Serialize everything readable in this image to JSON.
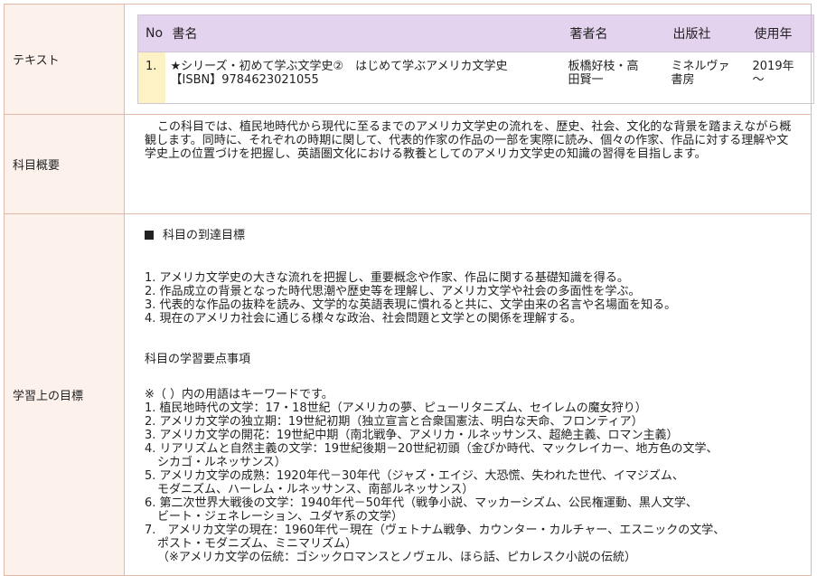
{
  "sections": {
    "text_label": "テキスト",
    "summary_label": "科目概要",
    "goals_label": "学習上の目標"
  },
  "books": {
    "headers": {
      "no": "No",
      "title": "書名",
      "author": "著者名",
      "publisher": "出版社",
      "year": "使用年"
    },
    "rows": [
      {
        "no": "1.",
        "title_line1": "★シリーズ・初めて学ぶ文学史②　はじめて学ぶアメリカ文学史",
        "title_line2": "【ISBN】9784623021055",
        "author_line1": "板橋好枝・高",
        "author_line2": "田賢一",
        "publisher_line1": "ミネルヴァ",
        "publisher_line2": "書房",
        "year_line1": "2019年",
        "year_line2": "～"
      }
    ]
  },
  "summary": "この科目では、植民地時代から現代に至るまでのアメリカ文学史の流れを、歴史、社会、文化的な背景を踏まえながら概観します。同時に、それぞれの時期に関して、代表的作家の作品の一部を実際に読み、個々の作家、作品に対する理解や文学史上の位置づけを把握し、英語圏文化における教養としてのアメリカ文学史の知識の習得を目指します。",
  "goals": {
    "heading1": "科目の到達目標",
    "targets": [
      "1. アメリカ文学史の大きな流れを把握し、重要概念や作家、作品に関する基礎知識を得る。",
      "2. 作品成立の背景となった時代思潮や歴史等を理解し、アメリカ文学や社会の多面性を学ぶ。",
      "3. 代表的な作品の抜粋を読み、文学的な英語表現に慣れると共に、文学由来の名言や名場面を知る。",
      "4. 現在のアメリカ社会に通じる様々な政治、社会問題と文学との関係を理解する。"
    ],
    "heading2": "科目の学習要点事項",
    "note": "※（ ）内の用語はキーワードです。",
    "points": [
      {
        "line1": "1. 植民地時代の文学：17・18世紀（アメリカの夢、ピューリタニズム、セイレムの魔女狩り）",
        "line2": ""
      },
      {
        "line1": "2. アメリカ文学の独立期：19世紀初期（独立宣言と合衆国憲法、明白な天命、フロンティア）",
        "line2": ""
      },
      {
        "line1": "3. アメリカ文学の開花：19世紀中期（南北戦争、アメリカ・ルネッサンス、超絶主義、ロマン主義）",
        "line2": ""
      },
      {
        "line1": "4. リアリズムと自然主義の文学：19世紀後期－20世紀初頭（金ぴか時代、マックレイカー、地方色の文学、",
        "line2": "シカゴ・ルネッサンス）"
      },
      {
        "line1": "5. アメリカ文学の成熟：1920年代－30年代（ジャズ・エイジ、大恐慌、失われた世代、イマジズム、",
        "line2": "モダニズム、ハーレム・ルネッサンス、南部ルネッサンス）"
      },
      {
        "line1": "6. 第二次世界大戦後の文学：1940年代－50年代（戦争小説、マッカーシズム、公民権運動、黒人文学、",
        "line2": "ビート・ジェネレーション、ユダヤ系の文学）"
      },
      {
        "line1": "7.　アメリカ文学の現在：1960年代－現在（ヴェトナム戦争、カウンター・カルチャー、エスニックの文学、",
        "line2": "ポスト・モダニズム、ミニマリズム）"
      }
    ],
    "tail": "（※アメリカ文学の伝統：ゴシックロマンスとノヴェル、ほら話、ピカレスク小説の伝統）"
  }
}
